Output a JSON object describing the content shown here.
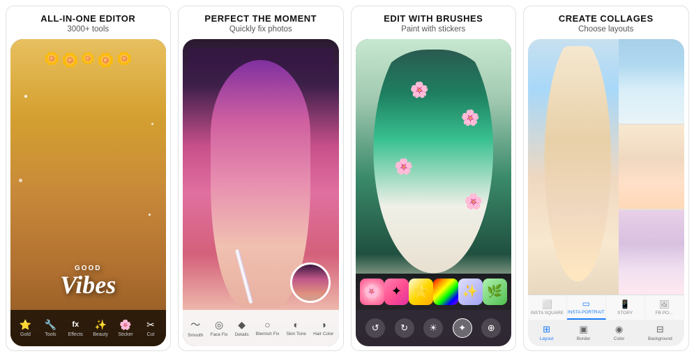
{
  "panels": [
    {
      "id": "panel1",
      "title": "ALL-IN-ONE EDITOR",
      "subtitle": "3000+ tools",
      "text_overlay_top": "GOOD",
      "text_overlay_main": "Vibes",
      "bottom_icons": [
        {
          "label": "Gold",
          "icon": "⭐"
        },
        {
          "label": "Tools",
          "icon": "🔧"
        },
        {
          "label": "Effects",
          "icon": "fx"
        },
        {
          "label": "Beauty",
          "icon": "✨"
        },
        {
          "label": "Sticker",
          "icon": "🌸"
        },
        {
          "label": "Cut",
          "icon": "✂"
        }
      ]
    },
    {
      "id": "panel2",
      "title": "PERFECT THE MOMENT",
      "subtitle": "Quickly fix photos",
      "bottom_icons": [
        {
          "label": "Smooth",
          "icon": "〜"
        },
        {
          "label": "Face Fix",
          "icon": "◎"
        },
        {
          "label": "Details",
          "icon": "◆"
        },
        {
          "label": "Blemish Fix",
          "icon": "○"
        },
        {
          "label": "Skin Tone",
          "icon": "◐"
        },
        {
          "label": "Hair Color",
          "icon": "◑"
        }
      ]
    },
    {
      "id": "panel3",
      "title": "EDIT WITH BRUSHES",
      "subtitle": "Paint with stickers",
      "sticker_types": [
        "🌸",
        "🌺",
        "✦",
        "🌈",
        "✨"
      ],
      "bottom_icons": [
        {
          "icon": "↺",
          "active": false
        },
        {
          "icon": "↻",
          "active": false
        },
        {
          "icon": "☀",
          "active": false
        },
        {
          "icon": "✦",
          "active": true
        },
        {
          "icon": "⊕",
          "active": false
        }
      ]
    },
    {
      "id": "panel4",
      "title": "CREATE COLLAGES",
      "subtitle": "Choose layouts",
      "tabs": [
        {
          "label": "INSTA SQUARE",
          "active": false
        },
        {
          "label": "INSTA PORTRAIT",
          "active": true
        },
        {
          "label": "STORY",
          "active": false
        },
        {
          "label": "FB PO...",
          "active": false
        }
      ],
      "bottom_actions": [
        {
          "label": "Layout",
          "icon": "⊞",
          "active": true
        },
        {
          "label": "Border",
          "icon": "▣",
          "active": false
        },
        {
          "label": "Color",
          "icon": "◉",
          "active": false
        },
        {
          "label": "Background",
          "icon": "⊟",
          "active": false
        }
      ]
    }
  ]
}
